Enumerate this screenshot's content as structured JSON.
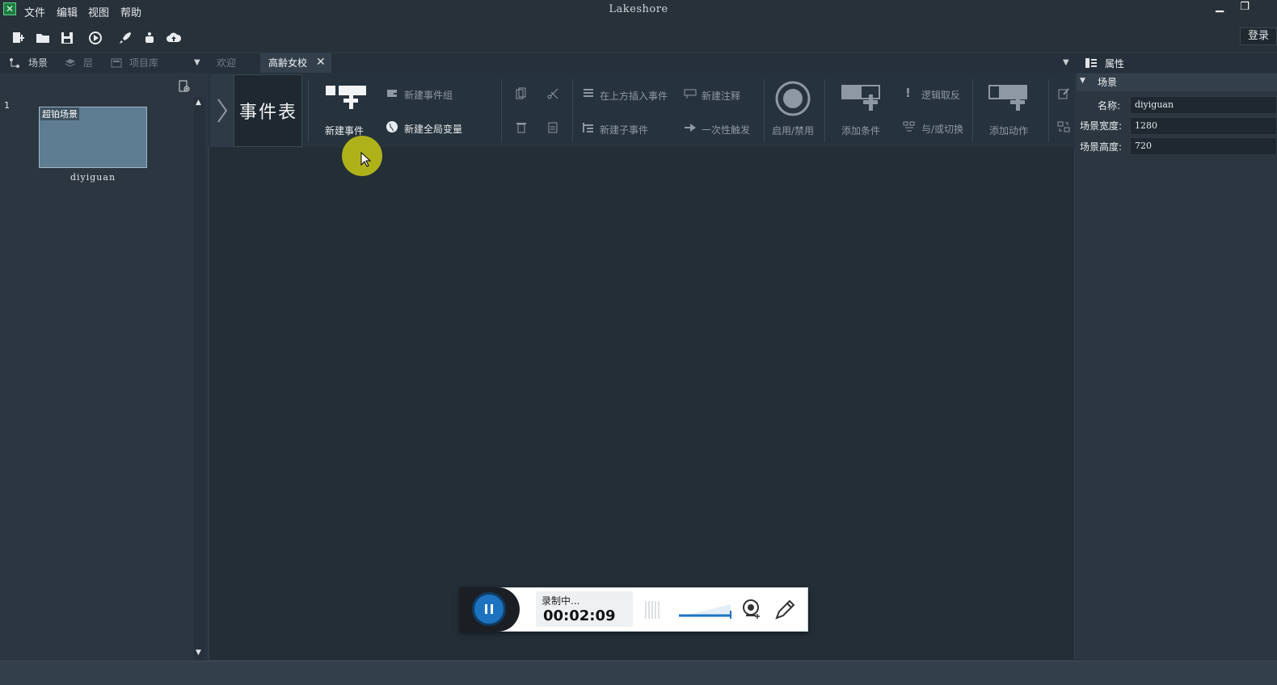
{
  "window": {
    "title": "Lakeshore",
    "login_label": "登录"
  },
  "menu": [
    "文件",
    "编辑",
    "视图",
    "帮助"
  ],
  "left_tabs": {
    "scene": "场景",
    "layers": "层",
    "project": "项目库"
  },
  "center_tabs": {
    "welcome": "欢迎",
    "active": "高齢女校"
  },
  "scene_list": {
    "index": "1",
    "thumb_label": "超铂场景",
    "scene_name": "diyiguan"
  },
  "ribbon": {
    "sheet_title": "事件表",
    "new_event": "新建事件",
    "new_event_group": "新建事件组",
    "new_global_var": "新建全局变量",
    "insert_above": "在上方插入事件",
    "new_sub_event": "新建子事件",
    "new_comment": "新建注释",
    "trigger_once": "一次性触发",
    "enable_disable": "启用/禁用",
    "add_condition": "添加条件",
    "logic_invert": "逻辑取反",
    "and_or_toggle": "与/或切换",
    "add_action": "添加动作"
  },
  "properties": {
    "panel_title": "属性",
    "section": "场景",
    "rows": [
      {
        "label": "名称:",
        "value": "diyiguan"
      },
      {
        "label": "场景宽度:",
        "value": "1280"
      },
      {
        "label": "场景高度:",
        "value": "720"
      }
    ]
  },
  "recorder": {
    "status": "录制中...",
    "time": "00:02:09"
  },
  "colors": {
    "accent_blue": "#1e73c0",
    "panel_bg": "#2b3640",
    "canvas_bg": "#232e37"
  }
}
